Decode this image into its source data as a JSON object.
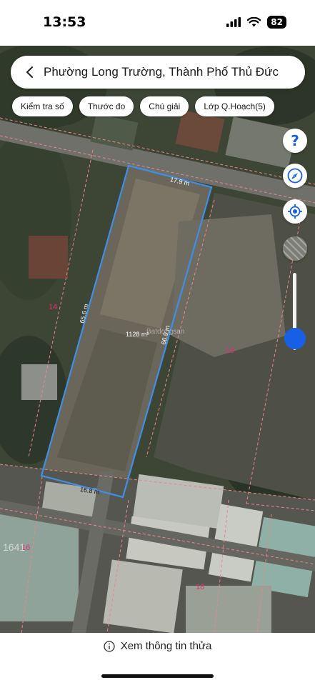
{
  "status_bar": {
    "time": "13:53",
    "battery": "82"
  },
  "search": {
    "title": "Phường Long Trường, Thành Phố Thủ Đức"
  },
  "toolbar": {
    "chips": [
      {
        "label": "Kiểm tra số"
      },
      {
        "label": "Thước đo"
      },
      {
        "label": "Chú giải"
      },
      {
        "label": "Lớp Q.Hoạch(5)"
      }
    ]
  },
  "map_controls": {
    "help_icon": "?",
    "compass_icon": "compass-icon",
    "locate_icon": "locate-icon",
    "layer_icon": "layer-icon",
    "zoom_level": 0.85
  },
  "parcel": {
    "top_edge": "17.9 m",
    "left_edge": "65.6 m",
    "right_edge": "66.9 m",
    "bottom_edge": "16.8 m",
    "area": "1128 m²",
    "watermark": "Batdongsan"
  },
  "lot_numbers": {
    "lot_14": "14",
    "lot_19": "19",
    "lot_16": "16",
    "lot_18": "18",
    "lot_1641": "1641"
  },
  "colors": {
    "parcel_outline": "#3f8fe8",
    "boundary_lines": "#e08080",
    "lot_label": "#e0307a",
    "accent": "#1760e6"
  },
  "bottom": {
    "info_label": "Xem thông tin thửa"
  }
}
